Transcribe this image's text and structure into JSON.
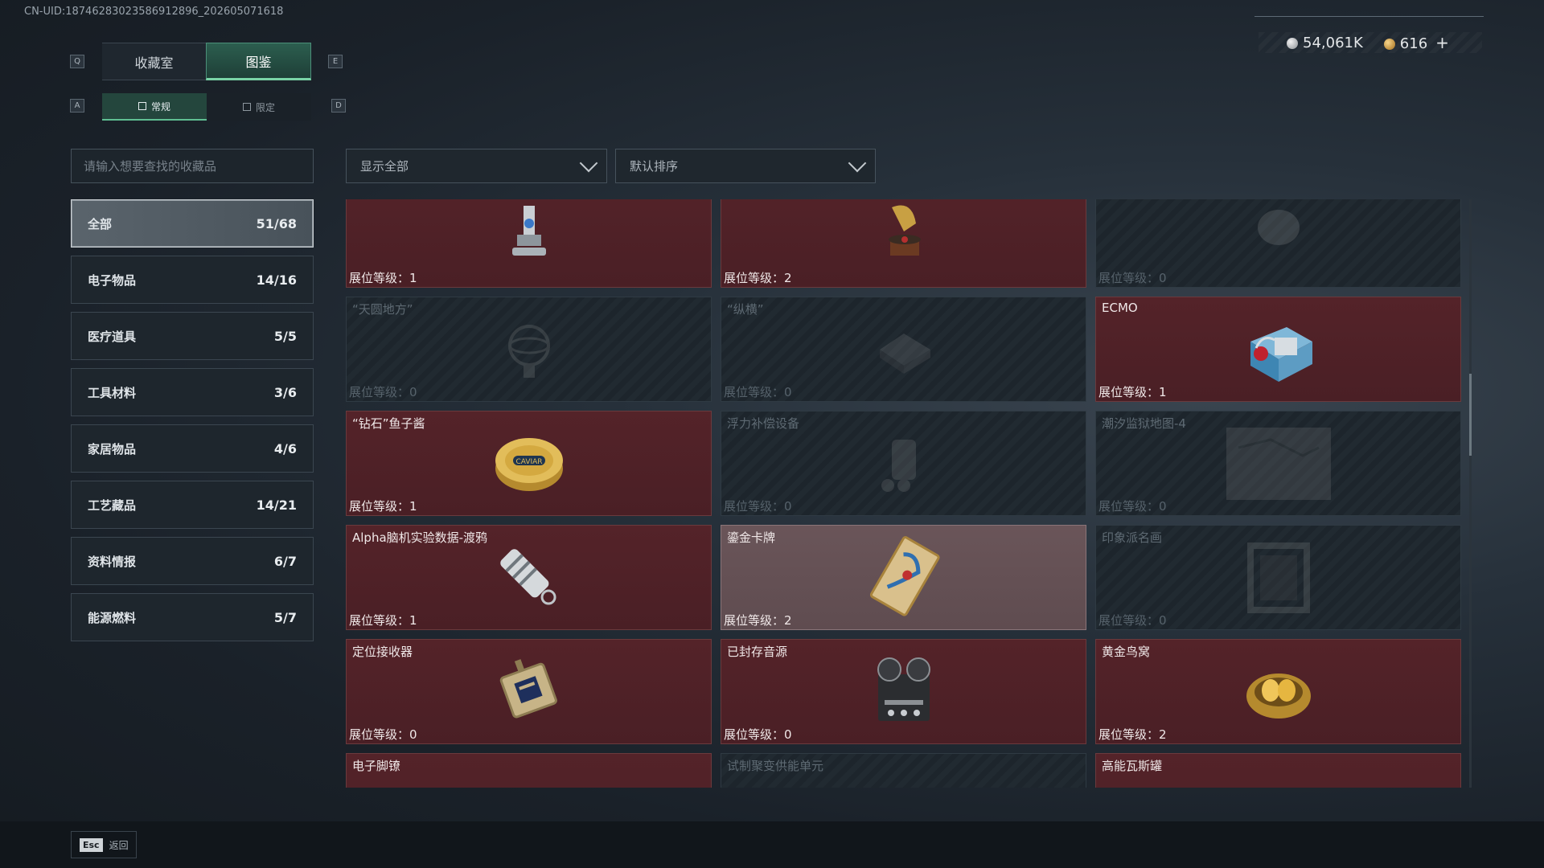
{
  "uid": "CN-UID:18746283023586912896_202605071618",
  "currency": {
    "silver": "54,061K",
    "gold": "616",
    "plus": "+"
  },
  "keys": {
    "left_tab": "Q",
    "right_tab": "E",
    "left_sub": "A",
    "right_sub": "D"
  },
  "tabs": [
    {
      "label": "收藏室"
    },
    {
      "label": "图鉴"
    }
  ],
  "subtabs": [
    {
      "label": "常规"
    },
    {
      "label": "限定"
    }
  ],
  "search": {
    "placeholder": "请输入想要查找的收藏品"
  },
  "filters": {
    "display": "显示全部",
    "sort": "默认排序"
  },
  "categories": [
    {
      "label": "全部",
      "count": "51/68"
    },
    {
      "label": "电子物品",
      "count": "14/16"
    },
    {
      "label": "医疗道具",
      "count": "5/5"
    },
    {
      "label": "工具材料",
      "count": "3/6"
    },
    {
      "label": "家居物品",
      "count": "4/6"
    },
    {
      "label": "工艺藏品",
      "count": "14/21"
    },
    {
      "label": "资料情报",
      "count": "6/7"
    },
    {
      "label": "能源燃料",
      "count": "5/7"
    }
  ],
  "items": [
    {
      "name": "",
      "level": "展位等级：1",
      "state": "owned",
      "icon": "robot-arm-icon"
    },
    {
      "name": "",
      "level": "展位等级：2",
      "state": "owned",
      "icon": "gramophone-icon"
    },
    {
      "name": "",
      "level": "展位等级：0",
      "state": "locked",
      "icon": "mystery-item-icon"
    },
    {
      "name": "“天圆地方”",
      "level": "展位等级：0",
      "state": "locked",
      "icon": "armillary-icon"
    },
    {
      "name": "“纵横”",
      "level": "展位等级：0",
      "state": "locked",
      "icon": "chessboard-icon"
    },
    {
      "name": "ECMO",
      "level": "展位等级：1",
      "state": "owned",
      "icon": "ecmo-machine-icon"
    },
    {
      "name": "“钻石”鱼子酱",
      "level": "展位等级：1",
      "state": "owned",
      "icon": "caviar-tin-icon"
    },
    {
      "name": "浮力补偿设备",
      "level": "展位等级：0",
      "state": "locked",
      "icon": "buoyancy-device-icon"
    },
    {
      "name": "潮汐监狱地图-4",
      "level": "展位等级：0",
      "state": "locked",
      "icon": "map-icon"
    },
    {
      "name": "Alpha脑机实验数据-渡鸦",
      "level": "展位等级：1",
      "state": "owned",
      "icon": "data-cylinder-icon"
    },
    {
      "name": "鎏金卡牌",
      "level": "展位等级：2",
      "state": "owned-light",
      "icon": "gilded-card-icon"
    },
    {
      "name": "印象派名画",
      "level": "展位等级：0",
      "state": "locked",
      "icon": "painting-frame-icon"
    },
    {
      "name": "定位接收器",
      "level": "展位等级：0",
      "state": "owned",
      "icon": "receiver-icon"
    },
    {
      "name": "已封存音源",
      "level": "展位等级：0",
      "state": "owned",
      "icon": "reel-recorder-icon"
    },
    {
      "name": "黄金鸟窝",
      "level": "展位等级：2",
      "state": "owned",
      "icon": "golden-nest-icon"
    },
    {
      "name": "电子脚镣",
      "level": "",
      "state": "owned",
      "icon": "ankle-monitor-icon"
    },
    {
      "name": "试制聚变供能单元",
      "level": "",
      "state": "locked",
      "icon": "fusion-unit-icon"
    },
    {
      "name": "高能瓦斯罐",
      "level": "",
      "state": "owned",
      "icon": "gas-canister-icon"
    }
  ],
  "footer": {
    "key": "Esc",
    "label": "返回"
  },
  "colors": {
    "accent": "#79d3a6",
    "owned_card": "#4f2127",
    "locked_card": "#1f272e"
  }
}
